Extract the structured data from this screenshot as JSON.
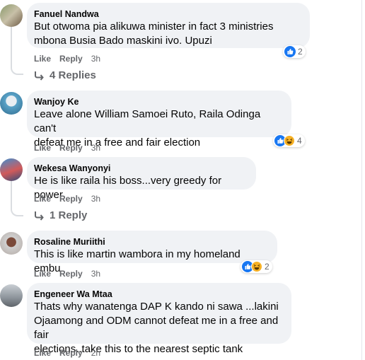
{
  "comments": [
    {
      "author": "Fanuel Nandwa",
      "lines": [
        "But otwoma pia alikuwa minister in fact 3 ministries",
        "mbona Busia Bado maskini ivo. Upuzi"
      ],
      "like": "Like",
      "reply": "Reply",
      "time": "3h",
      "reactions": "2",
      "replies": "4 Replies"
    },
    {
      "author": "Wanjoy Ke",
      "lines": [
        "Leave alone William Samoei Ruto, Raila Odinga can't",
        "defeat me in a free and fair election"
      ],
      "like": "Like",
      "reply": "Reply",
      "time": "3h",
      "reactions": "4"
    },
    {
      "author": "Wekesa Wanyonyi",
      "lines": [
        "He is like raila his boss...very greedy for power"
      ],
      "like": "Like",
      "reply": "Reply",
      "time": "3h",
      "replies": "1 Reply"
    },
    {
      "author": "Rosaline Muriithi",
      "lines": [
        "This is like martin wambora in my homeland embu"
      ],
      "like": "Like",
      "reply": "Reply",
      "time": "3h",
      "reactions": "2"
    },
    {
      "author": "Engeneer Wa Mtaa",
      "lines": [
        "Thats why wanatenga DAP K kando ni sawa ...lakini",
        "Ojaamong and ODM cannot defeat me in a free and fair",
        "elections..take this to the nearest septic tank"
      ],
      "like": "Like",
      "reply": "Reply",
      "time": "2h"
    }
  ],
  "icons": {
    "like": "like-reaction-icon",
    "haha": "haha-reaction-icon",
    "reply_arrow": "reply-arrow-icon"
  },
  "colors": {
    "bubble": "#f0f2f5",
    "meta": "#65676b",
    "like_blue": "#1877f2",
    "haha_yellow": "#f7b125"
  }
}
